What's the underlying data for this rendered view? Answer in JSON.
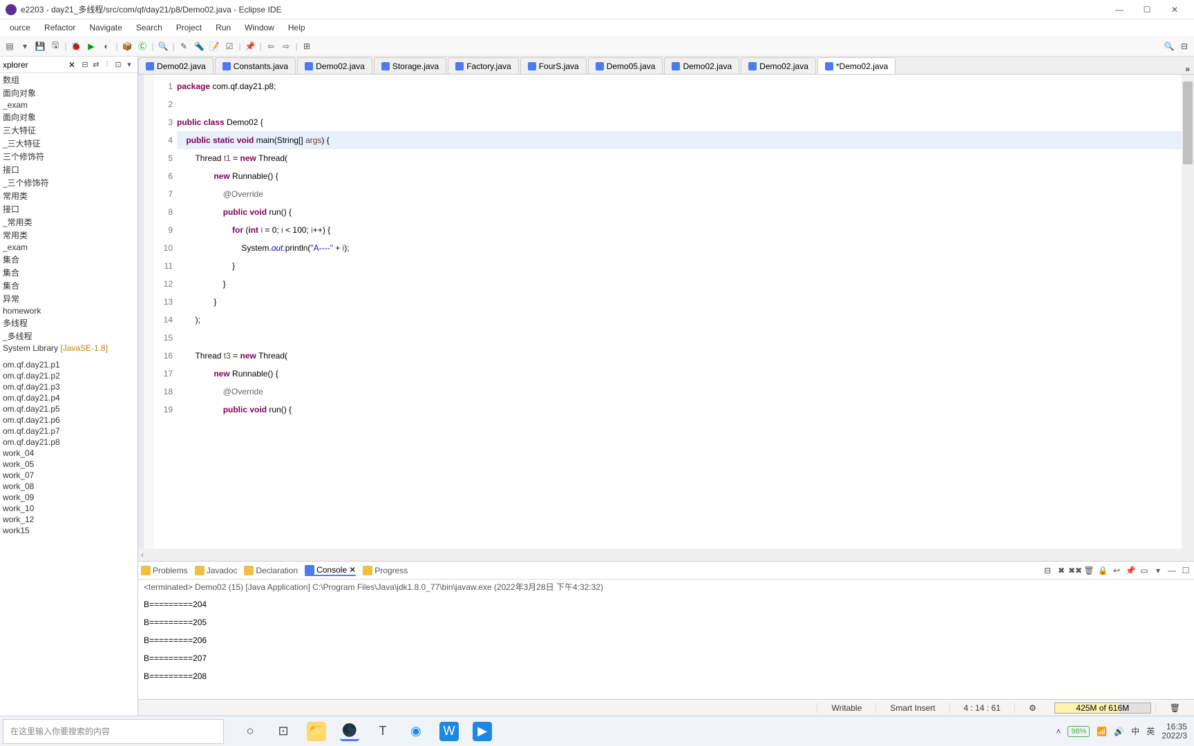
{
  "window": {
    "title": "e2203 - day21_多线程/src/com/qf/day21/p8/Demo02.java - Eclipse IDE"
  },
  "menus": [
    "ource",
    "Refactor",
    "Navigate",
    "Search",
    "Project",
    "Run",
    "Window",
    "Help"
  ],
  "explorer": {
    "title": "xplorer",
    "items": [
      "数组",
      "面向对象",
      "_exam",
      "面向对象",
      "三大特征",
      "_三大特征",
      "三个修饰符",
      "接口",
      "_三个修饰符",
      "常用类",
      "接口",
      "_常用类",
      "常用类",
      "_exam",
      "集合",
      "集合",
      "集合",
      "异常",
      "homework",
      "多线程",
      "_多线程"
    ],
    "jre": "System Library",
    "jre_ver": "[JavaSE-1.8]",
    "packages": [
      "om.qf.day21.p1",
      "om.qf.day21.p2",
      "om.qf.day21.p3",
      "om.qf.day21.p4",
      "om.qf.day21.p5",
      "om.qf.day21.p6",
      "om.qf.day21.p7",
      "om.qf.day21.p8"
    ],
    "works": [
      "work_04",
      "work_05",
      "work_07",
      "work_08",
      "work_09",
      "work_10",
      "work_12",
      "work15"
    ]
  },
  "tabs": [
    {
      "label": "Demo02.java"
    },
    {
      "label": "Constants.java"
    },
    {
      "label": "Demo02.java"
    },
    {
      "label": "Storage.java"
    },
    {
      "label": "Factory.java"
    },
    {
      "label": "FourS.java"
    },
    {
      "label": "Demo05.java"
    },
    {
      "label": "Demo02.java"
    },
    {
      "label": "Demo02.java"
    },
    {
      "label": "*Demo02.java",
      "active": true
    }
  ],
  "code": {
    "lines": [
      {
        "n": 1,
        "t": [
          {
            "k": "kw",
            "v": "package"
          },
          {
            "v": " com.qf.day21.p8;"
          }
        ]
      },
      {
        "n": 2,
        "t": []
      },
      {
        "n": 3,
        "t": [
          {
            "k": "kw",
            "v": "public class"
          },
          {
            "v": " Demo02 {"
          }
        ]
      },
      {
        "n": 4,
        "hl": true,
        "t": [
          {
            "v": "    "
          },
          {
            "k": "kw",
            "v": "public static void"
          },
          {
            "v": " main(String[] "
          },
          {
            "k": "var",
            "v": "args"
          },
          {
            "v": ") {"
          }
        ]
      },
      {
        "n": 5,
        "t": [
          {
            "v": "        Thread "
          },
          {
            "k": "var",
            "v": "t1"
          },
          {
            "v": " = "
          },
          {
            "k": "kw",
            "v": "new"
          },
          {
            "v": " Thread("
          }
        ]
      },
      {
        "n": 6,
        "t": [
          {
            "v": "                "
          },
          {
            "k": "kw",
            "v": "new"
          },
          {
            "v": " Runnable() {"
          }
        ]
      },
      {
        "n": 7,
        "t": [
          {
            "v": "                    "
          },
          {
            "k": "ann",
            "v": "@Override"
          }
        ]
      },
      {
        "n": 8,
        "t": [
          {
            "v": "                    "
          },
          {
            "k": "kw",
            "v": "public void"
          },
          {
            "v": " run() {"
          }
        ]
      },
      {
        "n": 9,
        "t": [
          {
            "v": "                        "
          },
          {
            "k": "kw",
            "v": "for"
          },
          {
            "v": " ("
          },
          {
            "k": "kw",
            "v": "int"
          },
          {
            "v": " "
          },
          {
            "k": "var",
            "v": "i"
          },
          {
            "v": " = 0; "
          },
          {
            "k": "var",
            "v": "i"
          },
          {
            "v": " < 100; "
          },
          {
            "k": "var",
            "v": "i"
          },
          {
            "v": "++) {"
          }
        ]
      },
      {
        "n": 10,
        "t": [
          {
            "v": "                            System."
          },
          {
            "k": "fld",
            "v": "out"
          },
          {
            "v": ".println("
          },
          {
            "k": "str",
            "v": "\"A----\""
          },
          {
            "v": " + "
          },
          {
            "k": "var",
            "v": "i"
          },
          {
            "v": ");"
          }
        ]
      },
      {
        "n": 11,
        "t": [
          {
            "v": "                        }"
          }
        ]
      },
      {
        "n": 12,
        "t": [
          {
            "v": "                    }"
          }
        ]
      },
      {
        "n": 13,
        "t": [
          {
            "v": "                }"
          }
        ]
      },
      {
        "n": 14,
        "t": [
          {
            "v": "        );"
          }
        ]
      },
      {
        "n": 15,
        "t": []
      },
      {
        "n": 16,
        "t": [
          {
            "v": "        Thread "
          },
          {
            "k": "var",
            "v": "t3"
          },
          {
            "v": " = "
          },
          {
            "k": "kw",
            "v": "new"
          },
          {
            "v": " Thread("
          }
        ]
      },
      {
        "n": 17,
        "t": [
          {
            "v": "                "
          },
          {
            "k": "kw",
            "v": "new"
          },
          {
            "v": " Runnable() {"
          }
        ]
      },
      {
        "n": 18,
        "t": [
          {
            "v": "                    "
          },
          {
            "k": "ann",
            "v": "@Override"
          }
        ]
      },
      {
        "n": 19,
        "t": [
          {
            "v": "                    "
          },
          {
            "k": "kw",
            "v": "public void"
          },
          {
            "v": " run() {"
          }
        ]
      }
    ]
  },
  "bottom": {
    "tabs": [
      "Problems",
      "Javadoc",
      "Declaration",
      "Console",
      "Progress"
    ],
    "active": 3,
    "term": "<terminated> Demo02 (15) [Java Application] C:\\Program Files\\Java\\jdk1.8.0_77\\bin\\javaw.exe (2022年3月28日 下午4:32:32)",
    "lines": [
      "B=========204",
      "B=========205",
      "B=========206",
      "B=========207",
      "B=========208"
    ]
  },
  "status": {
    "writable": "Writable",
    "insert": "Smart Insert",
    "pos": "4 : 14 : 61",
    "mem": "425M of 616M"
  },
  "taskbar": {
    "search_placeholder": "在这里输入你要搜索的内容",
    "battery": "98%",
    "ime1": "中",
    "ime2": "英",
    "time": "16:35",
    "date": "2022/3"
  }
}
